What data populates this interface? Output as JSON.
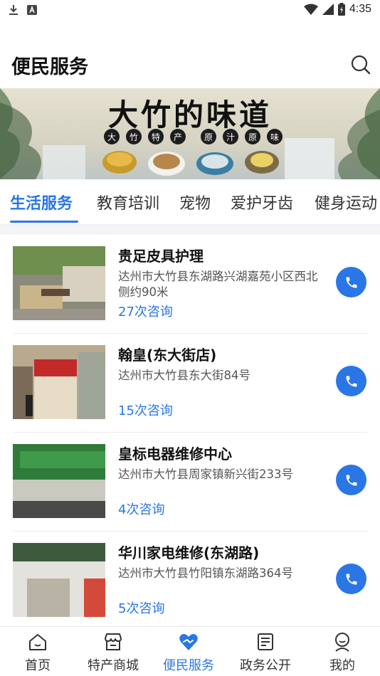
{
  "status_bar": {
    "time": "4:35",
    "icons": [
      "download-icon",
      "a-badge-icon",
      "wifi-icon",
      "signal-icon",
      "battery-icon"
    ]
  },
  "header": {
    "title": "便民服务",
    "search_icon": "search-icon"
  },
  "banner": {
    "title": "大竹的味道",
    "subtitle_chars": [
      "大",
      "竹",
      "特",
      "产",
      "原",
      "汁",
      "原",
      "味"
    ]
  },
  "tabs": [
    {
      "label": "生活服务",
      "active": true
    },
    {
      "label": "教育培训",
      "active": false
    },
    {
      "label": "宠物",
      "active": false
    },
    {
      "label": "爱护牙齿",
      "active": false
    },
    {
      "label": "健身运动",
      "active": false
    }
  ],
  "listings": [
    {
      "name": "贵足皮具护理",
      "address": "达州市大竹县东湖路兴湖嘉苑小区西北侧约90米",
      "consult_count": "27次咨询"
    },
    {
      "name": "翰皇(东大街店)",
      "address": "达州市大竹县东大街84号",
      "consult_count": "15次咨询"
    },
    {
      "name": "皇标电器维修中心",
      "address": "达州市大竹县周家镇新兴街233号",
      "consult_count": "4次咨询"
    },
    {
      "name": "华川家电维修(东湖路)",
      "address": "达州市大竹县竹阳镇东湖路364号",
      "consult_count": "5次咨询"
    }
  ],
  "bottom_nav": [
    {
      "label": "首页",
      "icon": "home-icon",
      "active": false
    },
    {
      "label": "特产商城",
      "icon": "store-icon",
      "active": false
    },
    {
      "label": "便民服务",
      "icon": "heart-handshake-icon",
      "active": true
    },
    {
      "label": "政务公开",
      "icon": "document-icon",
      "active": false
    },
    {
      "label": "我的",
      "icon": "profile-icon",
      "active": false
    }
  ],
  "colors": {
    "accent": "#2a76e6",
    "text": "#111111",
    "secondary_text": "#555555"
  }
}
